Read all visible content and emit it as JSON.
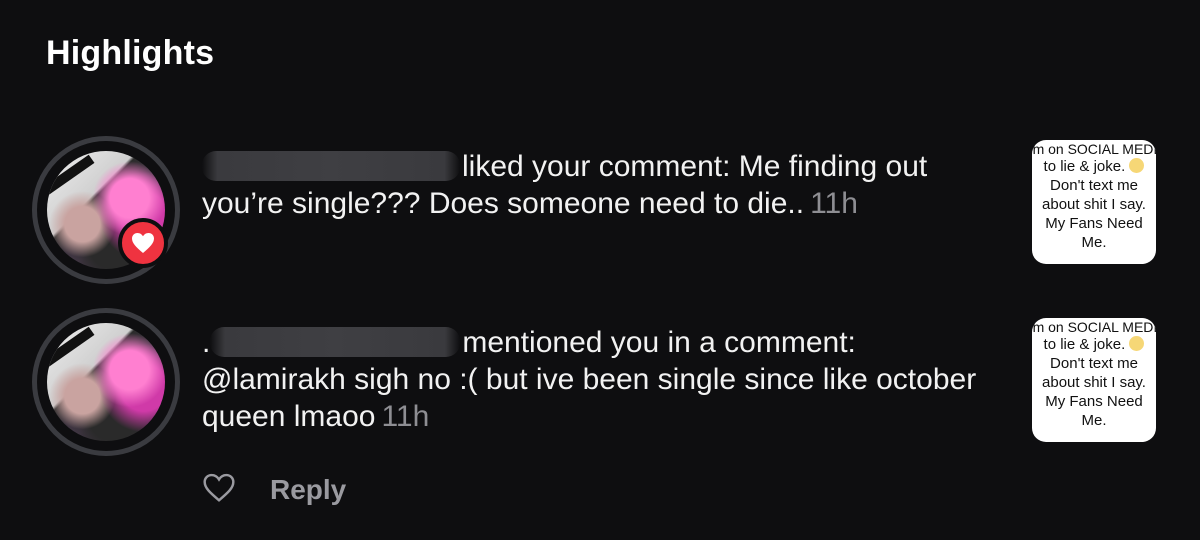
{
  "header": {
    "title": "Highlights"
  },
  "notifications": [
    {
      "action": "liked your comment: Me finding out you’re single??? Does someone need to die..",
      "time": "11h",
      "thumbnail": {
        "line1": "I'm on SOCIAL MEDIA",
        "line2": "to lie & joke.",
        "line3": "Don't text me",
        "line4": "about shit I say.",
        "line5": "My Fans Need",
        "line6": "Me."
      }
    },
    {
      "action_lead": ".",
      "action": "mentioned you in a comment: @lamirakh sigh no :( but ive been single since like october queen lmaoo",
      "time": "11h",
      "thumbnail": {
        "line1": "I'm on SOCIAL MEDIA",
        "line2": "to lie & joke.",
        "line3": "Don't text me",
        "line4": "about shit I say.",
        "line5": "My Fans Need",
        "line6": "Me."
      }
    }
  ],
  "reply": {
    "label": "Reply"
  },
  "colors": {
    "background": "#0e0e10",
    "heart_badge": "#ef3340",
    "muted": "#8e8e93"
  }
}
